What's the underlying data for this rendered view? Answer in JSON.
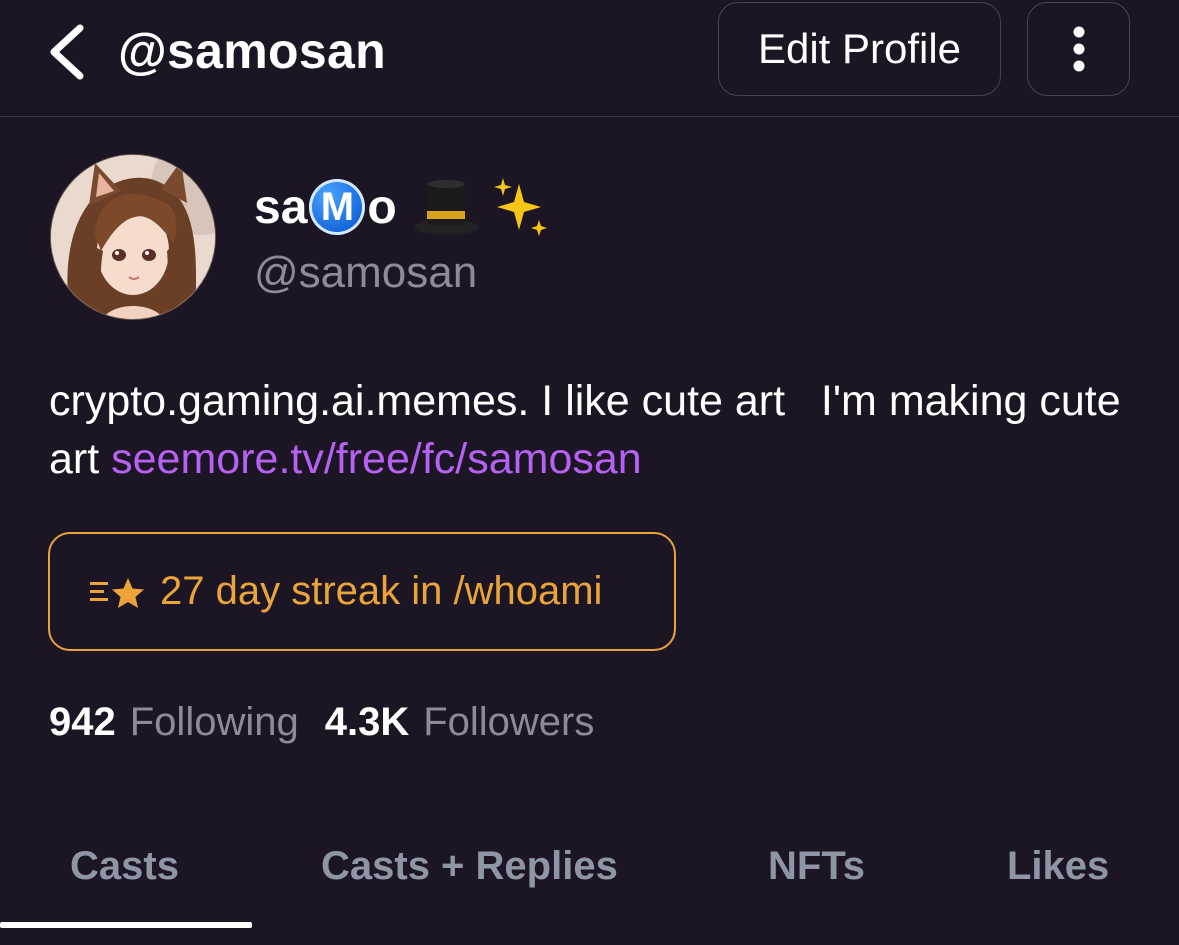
{
  "header": {
    "title": "@samosan",
    "edit_profile_label": "Edit Profile"
  },
  "profile": {
    "display_name_prefix": "sa",
    "display_name_badge": "M",
    "display_name_suffix": "o",
    "display_name_emojis": [
      "top-hat",
      "sparkles"
    ],
    "username": "@samosan",
    "bio_text": "crypto.gaming.ai.memes. I like cute art   I'm making cute art ",
    "bio_link": "seemore.tv/free/fc/samosan"
  },
  "streak": {
    "label": "27 day streak in /whoami",
    "accent_color": "#eba43a"
  },
  "stats": {
    "following_count": "942",
    "following_label": "Following",
    "followers_count": "4.3K",
    "followers_label": "Followers"
  },
  "tabs": [
    {
      "label": "Casts",
      "active": true
    },
    {
      "label": "Casts + Replies",
      "active": false
    },
    {
      "label": "NFTs",
      "active": false
    },
    {
      "label": "Likes",
      "active": false
    }
  ],
  "colors": {
    "background": "#1c1524",
    "link": "#b661f2",
    "muted": "#8e8a99"
  }
}
